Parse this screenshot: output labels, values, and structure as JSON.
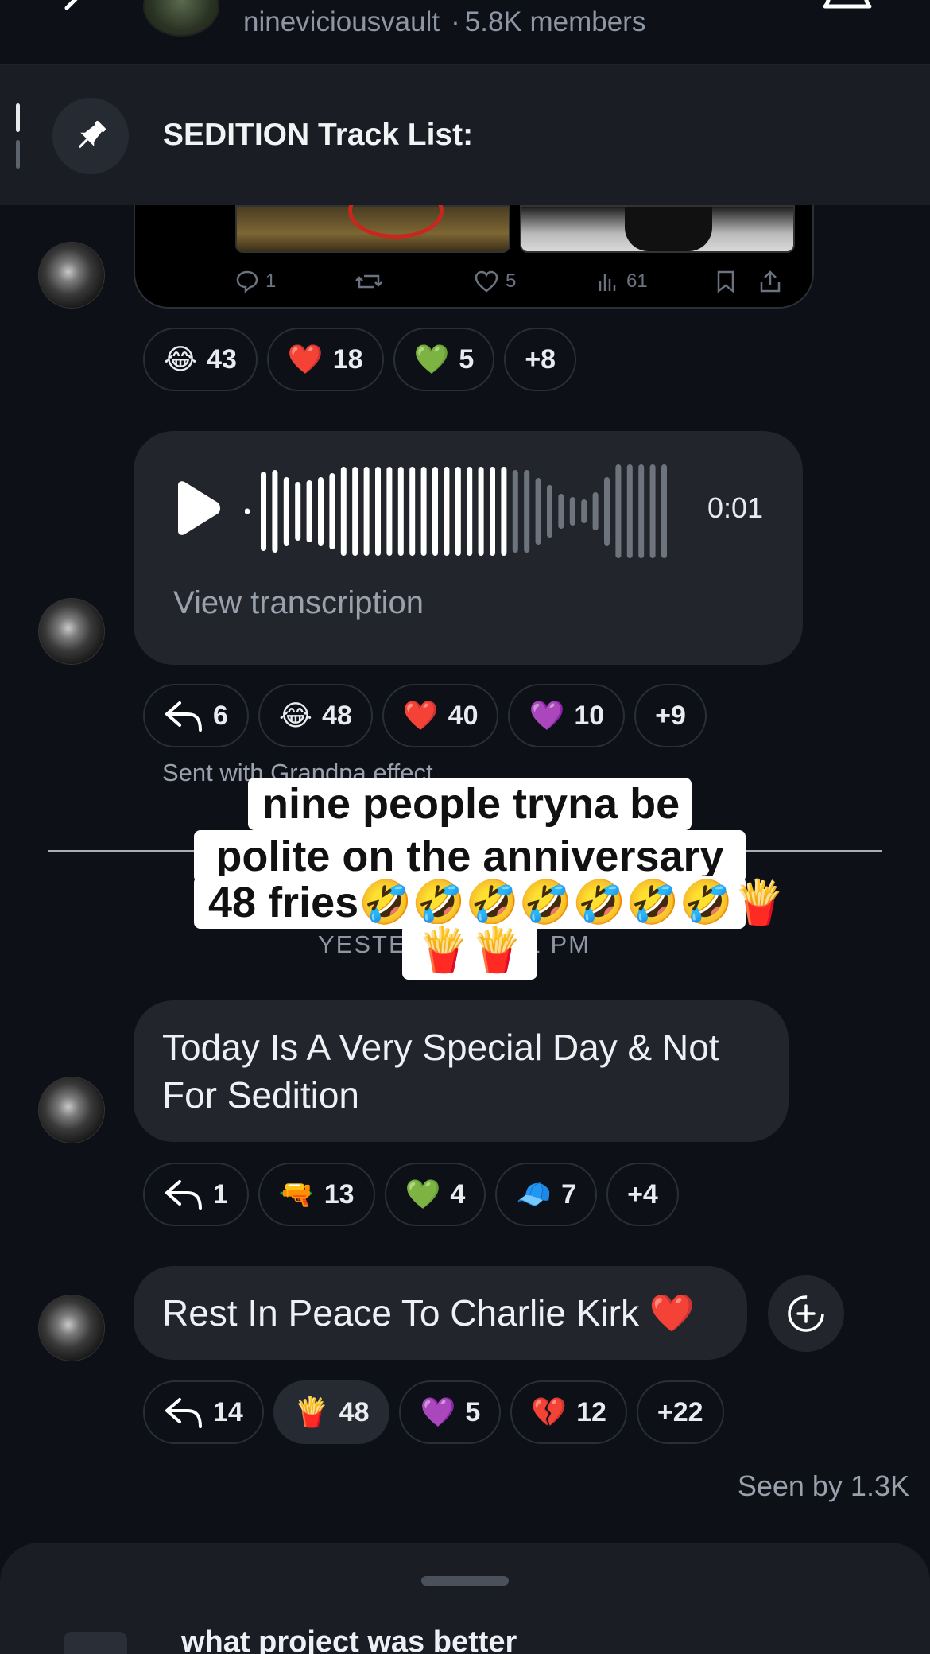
{
  "header": {
    "group_name": "nineviciousvault",
    "members": "5.8K members",
    "separator": "·"
  },
  "pinned": {
    "title": "SEDITION Track List:"
  },
  "embed": {
    "stats": {
      "replies": "1",
      "likes": "5",
      "views": "61"
    }
  },
  "messages": [
    {
      "reactions": [
        {
          "emoji": "😂",
          "count": "43"
        },
        {
          "emoji": "❤️",
          "count": "18"
        },
        {
          "emoji": "💚",
          "count": "5"
        },
        {
          "emoji": "",
          "count": "+8"
        }
      ]
    },
    {
      "voice": {
        "duration": "0:01",
        "transcription_label": "View transcription"
      },
      "reactions": [
        {
          "icon": "reply",
          "count": "6"
        },
        {
          "emoji": "😂",
          "count": "48"
        },
        {
          "emoji": "❤️",
          "count": "40"
        },
        {
          "emoji": "💜",
          "count": "10"
        },
        {
          "emoji": "",
          "count": "+9"
        }
      ],
      "effect_note": "Sent with Grandpa effect"
    },
    {
      "text": "Today Is A Very Special Day & Not For Sedition",
      "reactions": [
        {
          "icon": "reply",
          "count": "1"
        },
        {
          "emoji": "🔫",
          "count": "13"
        },
        {
          "emoji": "💚",
          "count": "4"
        },
        {
          "emoji": "🧢",
          "count": "7"
        },
        {
          "emoji": "",
          "count": "+4"
        }
      ]
    },
    {
      "text": "Rest In Peace To Charlie Kirk ❤️",
      "reactions": [
        {
          "icon": "reply",
          "count": "14"
        },
        {
          "emoji": "🍟",
          "count": "48",
          "selected": true
        },
        {
          "emoji": "💜",
          "count": "5"
        },
        {
          "emoji": "💔",
          "count": "12"
        },
        {
          "emoji": "",
          "count": "+22"
        }
      ]
    }
  ],
  "date_separator": "YESTERDAY 8:01 PM",
  "caption_overlay": {
    "line1": "nine people tryna be",
    "line2": "polite on the anniversary",
    "line3": "48 fries🤣🤣🤣🤣🤣🤣🤣🍟",
    "line4": "🍟🍟"
  },
  "seen_by": "Seen by 1.3K",
  "bottom_sheet": {
    "poll_question": "what project was better"
  },
  "colors": {
    "background": "#0d1117",
    "bubble": "#22262c",
    "muted_text": "#9aa1ad"
  }
}
